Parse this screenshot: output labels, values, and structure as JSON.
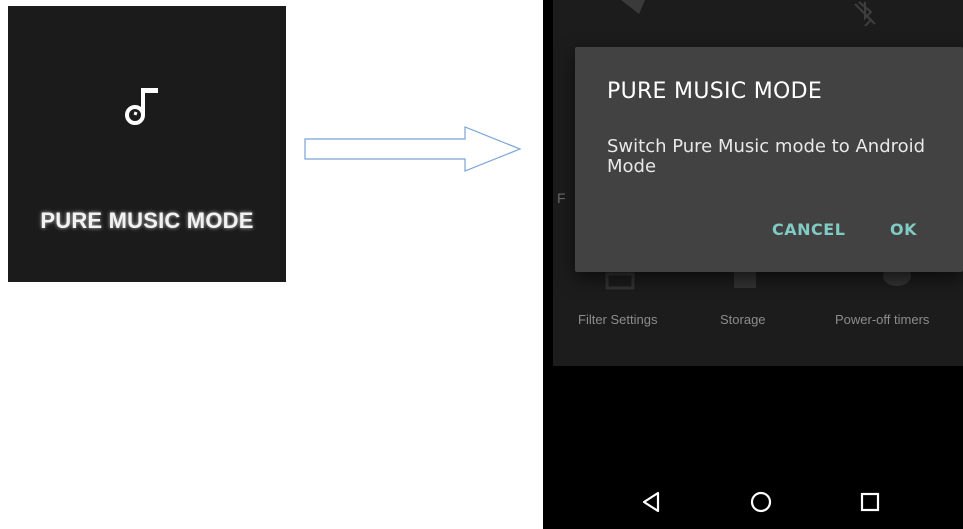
{
  "tile": {
    "icon": "music-note-icon",
    "label": "PURE MUSIC MODE"
  },
  "arrow": {
    "icon": "right-arrow-icon",
    "color": "#7aa4d8"
  },
  "quick_settings": {
    "top_icons": [
      "brightness-icon",
      "bluetooth-off-icon"
    ],
    "side_letter": "F",
    "tiles": [
      {
        "icon": "filter-icon",
        "label": "Filter Settings"
      },
      {
        "icon": "storage-icon",
        "label": "Storage"
      },
      {
        "icon": "timer-icon",
        "label": "Power-off timers"
      }
    ]
  },
  "dialog": {
    "title": "PURE MUSIC MODE",
    "message": "Switch Pure Music mode to Android Mode",
    "cancel_label": "CANCEL",
    "ok_label": "OK",
    "accent_color": "#80cbc4"
  },
  "nav_bar": {
    "back_icon": "back-triangle-icon",
    "home_icon": "home-circle-icon",
    "recents_icon": "recents-square-icon"
  }
}
